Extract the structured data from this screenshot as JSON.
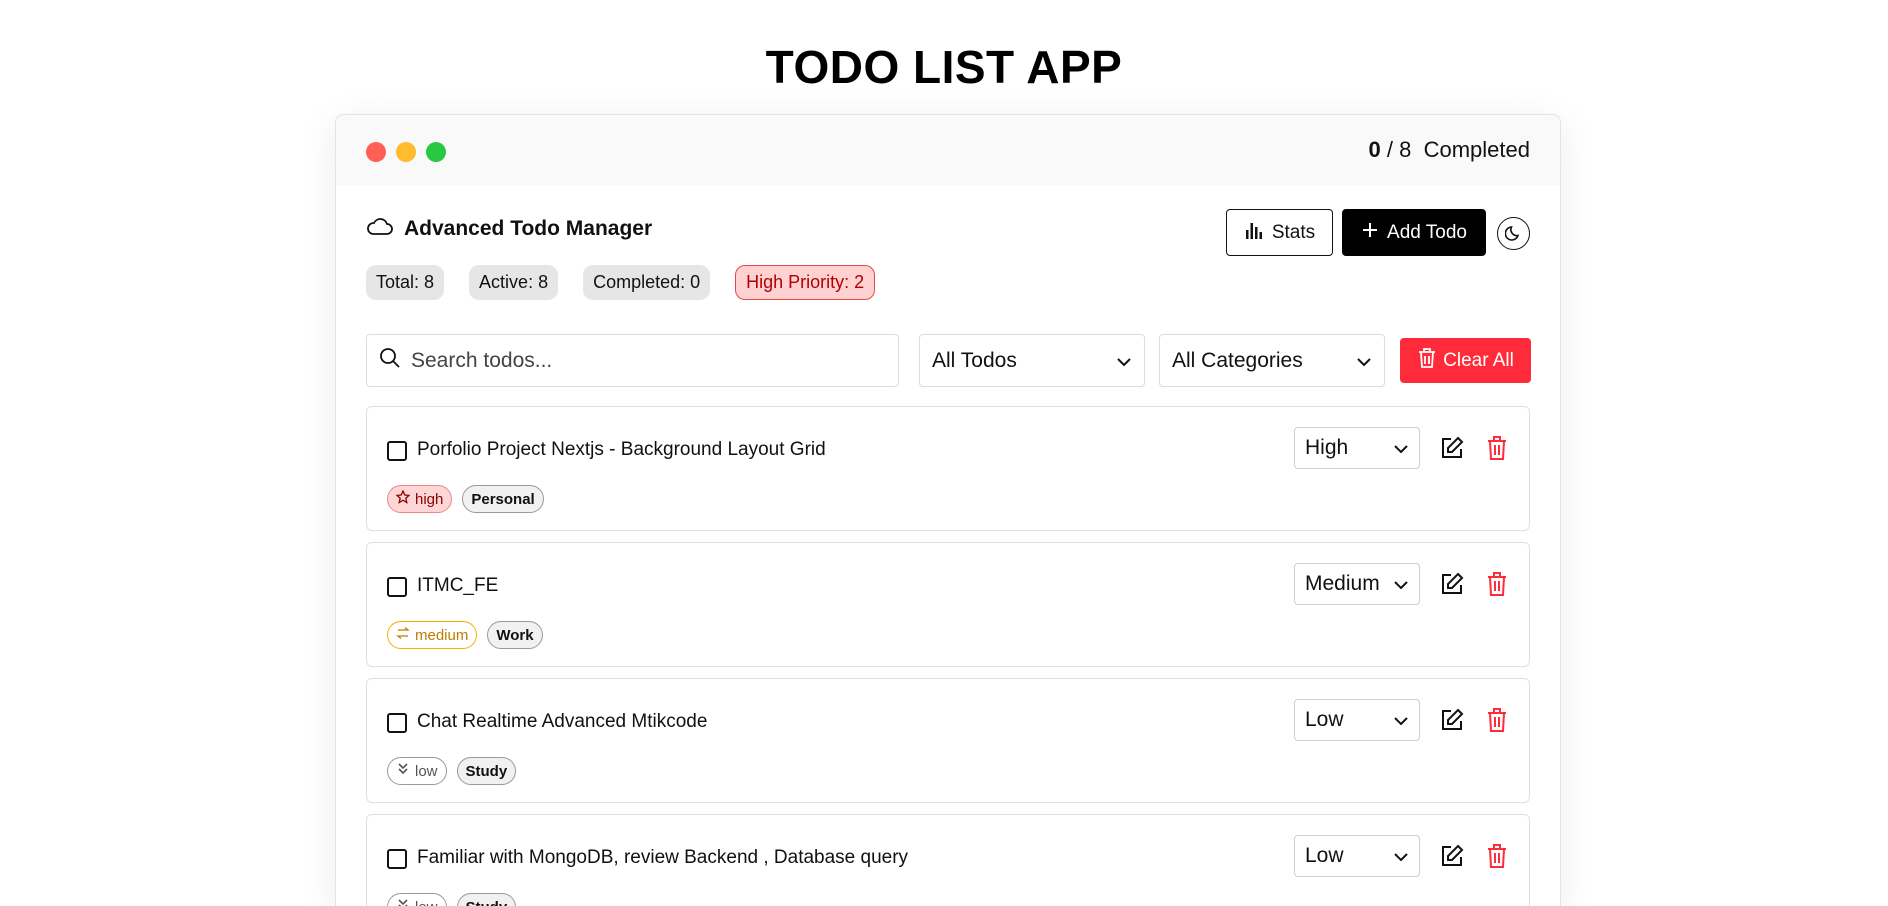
{
  "page": {
    "title": "TODO LIST APP"
  },
  "window": {
    "completed_count": "0",
    "separator": "/",
    "total_count": "8",
    "completed_label": "Completed"
  },
  "header": {
    "app_title": "Advanced Todo Manager",
    "stats_label": "Stats",
    "add_label": "Add Todo"
  },
  "stats": {
    "total": "Total: 8",
    "active": "Active: 8",
    "completed": "Completed: 0",
    "high_priority": "High Priority: 2"
  },
  "filters": {
    "search_placeholder": "Search todos...",
    "status_selected": "All Todos",
    "category_selected": "All Categories",
    "clear_label": "Clear All"
  },
  "todos": [
    {
      "title": "Porfolio Project Nextjs - Background Layout Grid",
      "priority_select": "High",
      "priority_tag": "high",
      "category": "Personal"
    },
    {
      "title": "ITMC_FE",
      "priority_select": "Medium",
      "priority_tag": "medium",
      "category": "Work"
    },
    {
      "title": "Chat Realtime Advanced Mtikcode",
      "priority_select": "Low",
      "priority_tag": "low",
      "category": "Study"
    },
    {
      "title": "Familiar with MongoDB, review Backend , Database query",
      "priority_select": "Low",
      "priority_tag": "low",
      "category": "Study"
    }
  ],
  "colors": {
    "accent": "#000000",
    "danger": "#ff2b3a",
    "dot_red": "#ff5f57",
    "dot_yellow": "#febc2e",
    "dot_green": "#28c840"
  }
}
